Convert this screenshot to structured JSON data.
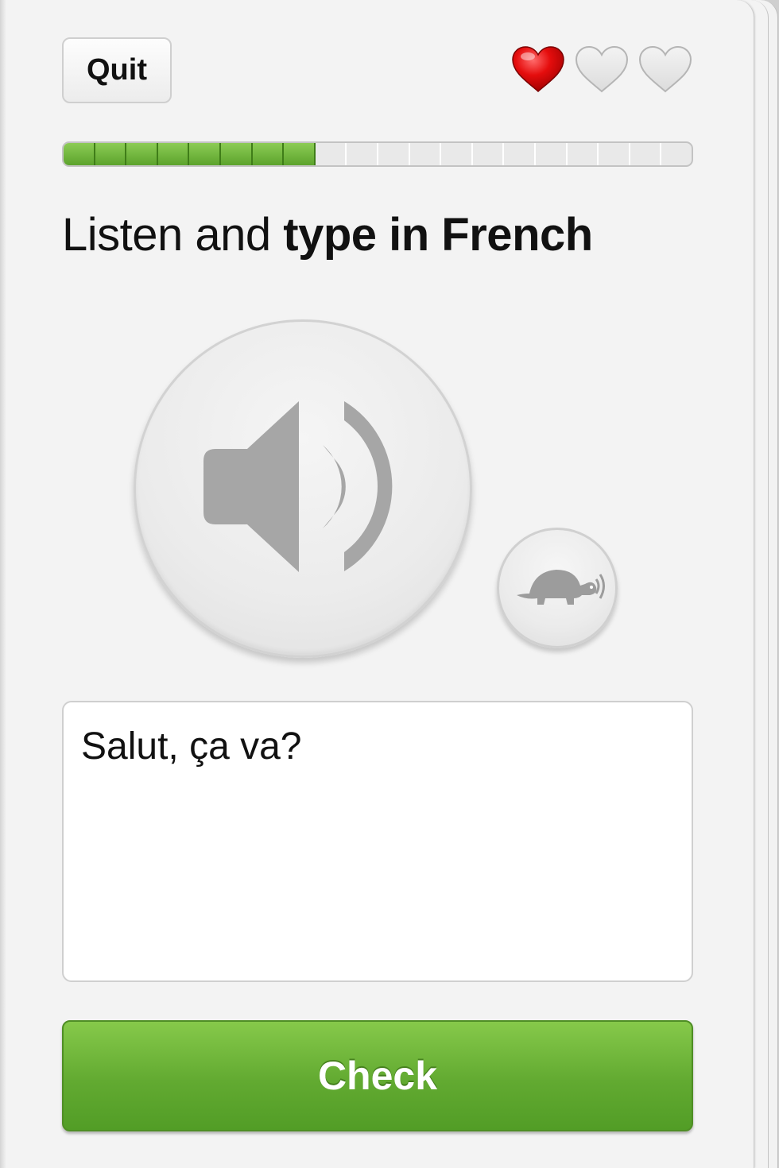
{
  "header": {
    "quit_label": "Quit",
    "lives": {
      "remaining": 1,
      "total": 3
    },
    "icons": [
      "heart-full-icon",
      "heart-empty-icon",
      "heart-empty-icon"
    ]
  },
  "progress": {
    "filled_segments": 8,
    "total_segments": 20
  },
  "instruction": {
    "normal": "Listen and ",
    "bold": "type in French"
  },
  "audio": {
    "play_icon": "speaker-icon",
    "slow_icon": "turtle-icon"
  },
  "answer": {
    "value": "Salut, ça va?"
  },
  "footer": {
    "check_label": "Check"
  },
  "colors": {
    "heart_full": "#e50d0d",
    "heart_empty": "#e2e2e2",
    "progress_fill": "#6db33a",
    "check_button": "#62aa31",
    "icon_gray": "#a6a6a6"
  }
}
